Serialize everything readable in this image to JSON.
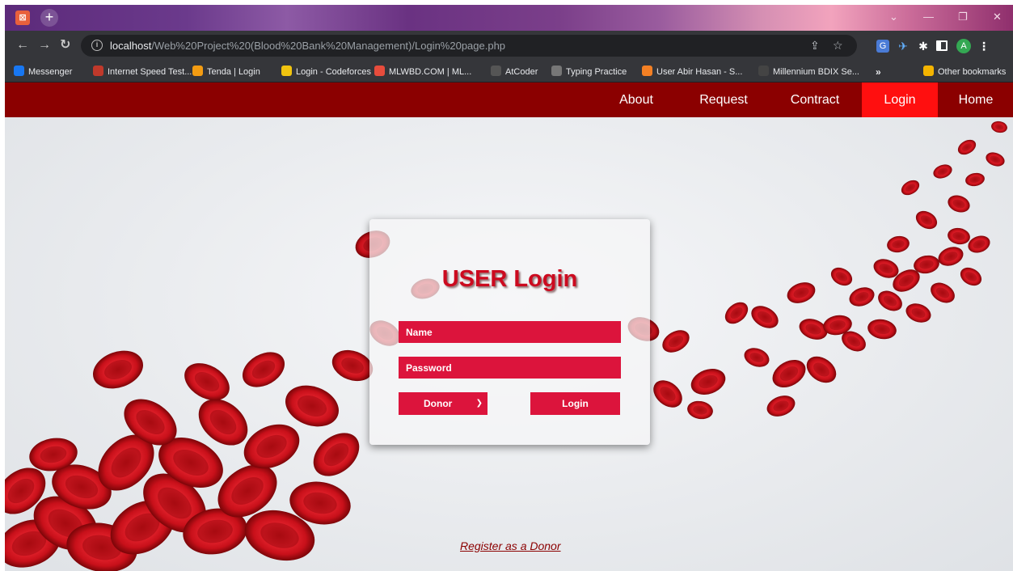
{
  "browser": {
    "new_tab_glyph": "+",
    "window_controls": [
      "⌄",
      "—",
      "❐",
      "✕"
    ],
    "url_host": "localhost",
    "url_path": "/Web%20Project%20(Blood%20Bank%20Management)/Login%20page.php",
    "nav_icons": [
      "back-icon",
      "forward-icon",
      "reload-icon"
    ],
    "bookmarks": [
      {
        "label": "Messenger",
        "color": "#1877f2"
      },
      {
        "label": "Internet Speed Test...",
        "color": "#c0392b"
      },
      {
        "label": "Tenda | Login",
        "color": "#f39c12"
      },
      {
        "label": "Login - Codeforces",
        "color": "#f1c40f"
      },
      {
        "label": "MLWBD.COM | ML...",
        "color": "#e74c3c"
      },
      {
        "label": "AtCoder",
        "color": "#555555"
      },
      {
        "label": "Typing Practice",
        "color": "#777777"
      },
      {
        "label": "User Abir Hasan - S...",
        "color": "#f48024"
      },
      {
        "label": "Millennium BDIX Se...",
        "color": "#444444"
      }
    ],
    "bookmarks_overflow": "»",
    "other_bookmarks": "Other bookmarks",
    "profile_initial": "A"
  },
  "site": {
    "nav": [
      "About",
      "Request",
      "Contract",
      "Login",
      "Home"
    ],
    "active_nav": "Login",
    "brand_color": "#8b0000",
    "accent_color": "#dc143c"
  },
  "login": {
    "title": "USER Login",
    "name_placeholder": "Name",
    "password_placeholder": "Password",
    "role_selected": "Donor",
    "submit_label": "Login"
  },
  "register_link": "Register as a Donor"
}
